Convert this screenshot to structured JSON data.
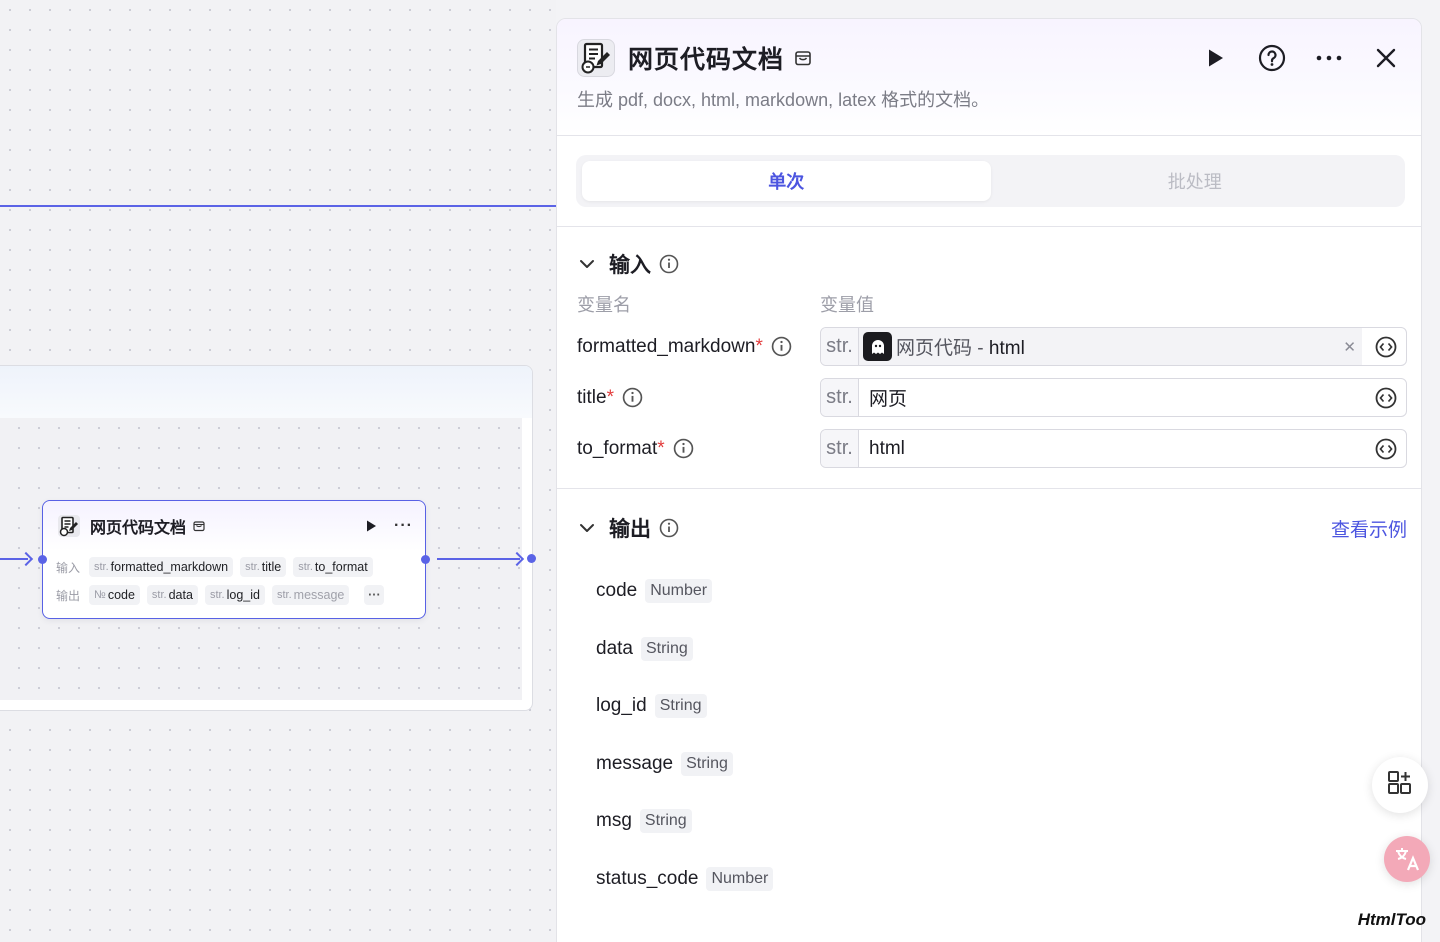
{
  "canvas": {
    "node": {
      "title": "网页代码文档",
      "input_label": "输入",
      "output_label": "输出",
      "inputs": [
        {
          "type": "str.",
          "name": "formatted_markdown"
        },
        {
          "type": "str.",
          "name": "title"
        },
        {
          "type": "str.",
          "name": "to_format"
        }
      ],
      "outputs": [
        {
          "type": "№",
          "name": "code"
        },
        {
          "type": "str.",
          "name": "data"
        },
        {
          "type": "str.",
          "name": "log_id"
        },
        {
          "type": "str.",
          "name": "message"
        }
      ],
      "more_label": "···"
    }
  },
  "panel": {
    "title": "网页代码文档",
    "description": "生成 pdf, docx, html, markdown, latex 格式的文档。",
    "tabs": [
      {
        "label": "单次",
        "active": true
      },
      {
        "label": "批处理",
        "active": false
      }
    ],
    "input_section": {
      "title": "输入",
      "col_name": "变量名",
      "col_value": "变量值",
      "rows": [
        {
          "name": "formatted_markdown",
          "required_mark": "*",
          "type": "str.",
          "ref_source": "网页代码",
          "ref_sep": " - ",
          "ref_field": "html"
        },
        {
          "name": "title",
          "required_mark": "*",
          "type": "str.",
          "value": "网页"
        },
        {
          "name": "to_format",
          "required_mark": "*",
          "type": "str.",
          "value": "html"
        }
      ]
    },
    "output_section": {
      "title": "输出",
      "example_link": "查看示例",
      "items": [
        {
          "name": "code",
          "type": "Number"
        },
        {
          "name": "data",
          "type": "String"
        },
        {
          "name": "log_id",
          "type": "String"
        },
        {
          "name": "message",
          "type": "String"
        },
        {
          "name": "msg",
          "type": "String"
        },
        {
          "name": "status_code",
          "type": "Number"
        }
      ]
    }
  },
  "watermark": "HtmlToo",
  "colors": {
    "accent": "#4c55e0",
    "edge": "#5b63e6",
    "required": "#e23c3c"
  }
}
